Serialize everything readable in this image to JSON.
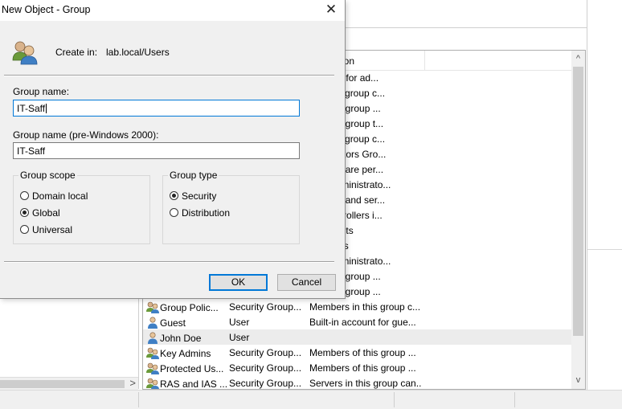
{
  "dialog": {
    "title": "New Object - Group",
    "close_glyph": "✕",
    "create_in_label": "Create in:",
    "create_in_path": "lab.local/Users",
    "group_name_label": "Group name:",
    "group_name_value": "IT-Saff",
    "group_name_pre2000_label": "Group name (pre-Windows 2000):",
    "group_name_pre2000_value": "IT-Saff",
    "group_scope": {
      "title": "Group scope",
      "options": [
        "Domain local",
        "Global",
        "Universal"
      ],
      "selected": "Global"
    },
    "group_type": {
      "title": "Group type",
      "options": [
        "Security",
        "Distribution"
      ],
      "selected": "Security"
    },
    "ok_label": "OK",
    "cancel_label": "Cancel"
  },
  "background": {
    "list_header_partial": "ion",
    "list_rows": [
      {
        "name": "",
        "type": "",
        "description": "account for ad...",
        "icon": ""
      },
      {
        "name": "",
        "type": "",
        "description": "s in this group c...",
        "icon": ""
      },
      {
        "name": "",
        "type": "",
        "description": "s of this group ...",
        "icon": ""
      },
      {
        "name": "",
        "type": "",
        "description": "s of this group t...",
        "icon": ""
      },
      {
        "name": "",
        "type": "",
        "description": "s in this group c...",
        "icon": ""
      },
      {
        "name": "",
        "type": "",
        "description": "ministrators Gro...",
        "icon": ""
      },
      {
        "name": "",
        "type": "",
        "description": "nts who are per...",
        "icon": ""
      },
      {
        "name": "",
        "type": "",
        "description": "cted administrato...",
        "icon": ""
      },
      {
        "name": "",
        "type": "",
        "description": "stations and ser...",
        "icon": ""
      },
      {
        "name": "",
        "type": "",
        "description": "ain controllers i...",
        "icon": ""
      },
      {
        "name": "",
        "type": "",
        "description": "ain guests",
        "icon": ""
      },
      {
        "name": "",
        "type": "",
        "description": "ain users",
        "icon": ""
      },
      {
        "name": "",
        "type": "",
        "description": "cted administrato...",
        "icon": ""
      },
      {
        "name": "",
        "type": "",
        "description": "s of this group ...",
        "icon": ""
      },
      {
        "name": "",
        "type": "",
        "description": "s of this group ...",
        "icon": ""
      },
      {
        "name": "Group Polic...",
        "type": "Security Group...",
        "description": "Members in this group c...",
        "icon": "group-icon"
      },
      {
        "name": "Guest",
        "type": "User",
        "description": "Built-in account for gue...",
        "icon": "user-icon"
      },
      {
        "name": "John Doe",
        "type": "User",
        "description": "",
        "icon": "user-icon"
      },
      {
        "name": "Key Admins",
        "type": "Security Group...",
        "description": "Members of this group ...",
        "icon": "group-icon"
      },
      {
        "name": "Protected Us...",
        "type": "Security Group...",
        "description": "Members of this group ...",
        "icon": "group-icon"
      },
      {
        "name": "RAS and IAS ...",
        "type": "Security Group...",
        "description": "Servers in this group can...",
        "icon": "group-icon"
      }
    ],
    "selected_row": "John Doe",
    "scroll_up_glyph": "^",
    "scroll_down_glyph": "v",
    "scroll_right_glyph": ">"
  }
}
